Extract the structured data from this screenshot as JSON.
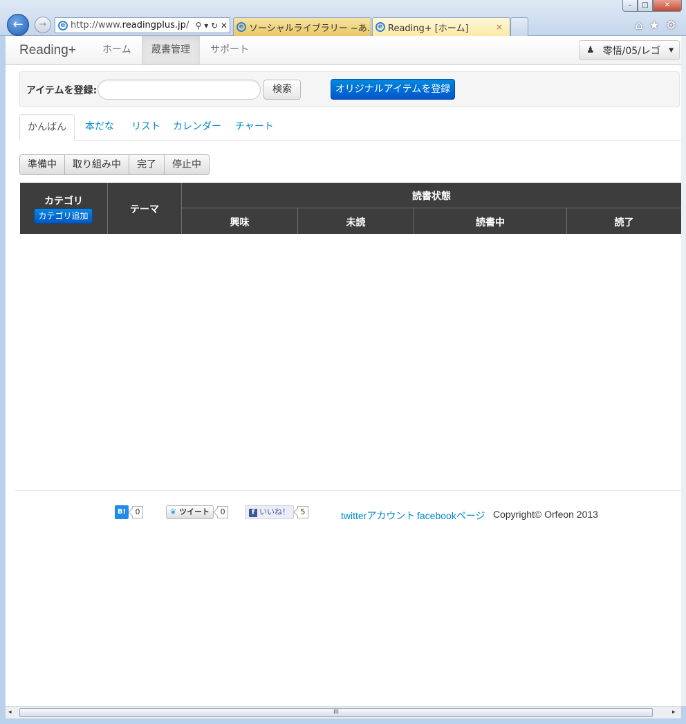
{
  "browser": {
    "window_buttons": {
      "minimize": "–",
      "maximize": "□",
      "close": "✕"
    },
    "address": {
      "url_prefix": "http://www.",
      "url_host": "readingplus.jp",
      "url_suffix": "/",
      "tools": "⚲ ▾ ↻ ✕"
    },
    "tabs": [
      {
        "title": "ソーシャルライブラリー ~あ..."
      },
      {
        "title": "Reading+ [ホーム]",
        "close": "×"
      }
    ],
    "icons": [
      "home-icon",
      "favorites-star-icon",
      "settings-gear-icon"
    ]
  },
  "navbar": {
    "brand": "Reading+",
    "items": [
      {
        "label": "ホーム",
        "active": false
      },
      {
        "label": "蔵書管理",
        "active": true
      },
      {
        "label": "サポート",
        "active": false
      }
    ],
    "user": "零悟/05/レゴ"
  },
  "register": {
    "label": "アイテムを登録:",
    "search_value": "",
    "search_button": "検索",
    "original_button": "オリジナルアイテムを登録"
  },
  "tabs": [
    {
      "label": "かんばん",
      "active": true
    },
    {
      "label": "本だな",
      "active": false
    },
    {
      "label": "リスト",
      "active": false
    },
    {
      "label": "カレンダー",
      "active": false
    },
    {
      "label": "チャート",
      "active": false
    }
  ],
  "status_filters": [
    "準備中",
    "取り組み中",
    "完了",
    "停止中"
  ],
  "kanban": {
    "category_header": "カテゴリ",
    "add_category_button": "カテゴリ追加",
    "theme_header": "テーマ",
    "reading_status_header": "読書状態",
    "status_columns": [
      "興味",
      "未読",
      "読書中",
      "読了"
    ]
  },
  "footer": {
    "hatena_label": "B!",
    "hatena_count": "0",
    "tweet_label": "ツイート",
    "tweet_count": "0",
    "like_label": "いいね！",
    "like_count": "5",
    "twitter_link": "twitterアカウント",
    "facebook_link": "facebookページ",
    "copyright": "Copyright© Orfeon 2013"
  },
  "scrollbar": {
    "left_arrow": "◂",
    "right_arrow": "▸",
    "grip": "III"
  },
  "colors": {
    "primary": "#0066cc",
    "link": "#0088cc",
    "table_header": "#3d3d3d"
  }
}
